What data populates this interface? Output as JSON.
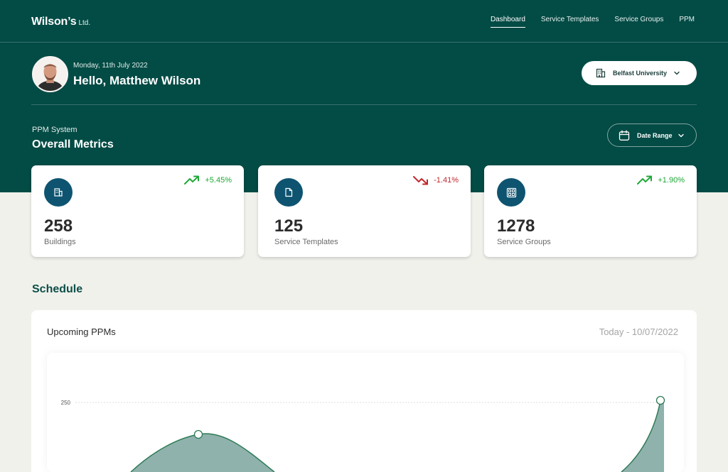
{
  "app": {
    "logo_main": "Wilson’s",
    "logo_sub": "Ltd."
  },
  "nav": [
    {
      "label": "Dashboard",
      "active": true
    },
    {
      "label": "Service Templates",
      "active": false
    },
    {
      "label": "Service Groups",
      "active": false
    },
    {
      "label": "PPM",
      "active": false
    }
  ],
  "user": {
    "date": "Monday, 11th July 2022",
    "greeting": "Hello, Matthew Wilson"
  },
  "site_selector": {
    "label": "Belfast University"
  },
  "metrics_section": {
    "caption": "PPM System",
    "title": "Overall Metrics",
    "date_range_label": "Date Range"
  },
  "metrics": [
    {
      "value": "258",
      "label": "Buildings",
      "trend": "+5.45%",
      "direction": "up",
      "icon": "building-icon"
    },
    {
      "value": "125",
      "label": "Service Templates",
      "trend": "-1.41%",
      "direction": "down",
      "icon": "document-icon"
    },
    {
      "value": "1278",
      "label": "Service Groups",
      "trend": "+1.90%",
      "direction": "up",
      "icon": "grid-building-icon"
    }
  ],
  "schedule": {
    "title": "Schedule",
    "card_title": "Upcoming PPMs",
    "date_label": "Today - 10/07/2022"
  },
  "colors": {
    "brand": "#034b45",
    "accent_blue": "#0e5470",
    "trend_up": "#1fa837",
    "trend_down": "#c1272d",
    "area_fill": "#8fb2ac",
    "area_stroke": "#2f7b57"
  },
  "chart_data": {
    "type": "area",
    "y_ticks": [
      250
    ],
    "gridlines": true
  }
}
